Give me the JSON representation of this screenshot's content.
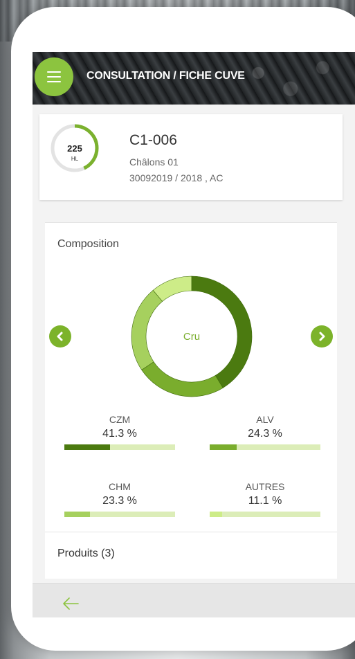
{
  "header": {
    "title": "CONSULTATION / FICHE CUVE",
    "menu_icon": "hamburger-menu-icon"
  },
  "tank": {
    "volume": "225",
    "unit": "HL",
    "fill_fraction": 0.43,
    "code": "C1-006",
    "location": "Châlons 01",
    "lot": "30092019 / 2018 , AC"
  },
  "composition": {
    "title": "Composition",
    "center_label": "Cru",
    "prev_icon": "chevron-left-icon",
    "next_icon": "chevron-right-icon",
    "chart_data": {
      "type": "pie",
      "categories": [
        "CZM",
        "ALV",
        "CHM",
        "AUTRES"
      ],
      "values": [
        41.3,
        24.3,
        23.3,
        11.1
      ],
      "colors": [
        "#4b7a10",
        "#7aad2d",
        "#a6d05e",
        "#cdec88"
      ],
      "title": ""
    },
    "items": [
      {
        "name": "CZM",
        "percent": "41.3 %",
        "value": 41.3
      },
      {
        "name": "ALV",
        "percent": "24.3 %",
        "value": 24.3
      },
      {
        "name": "CHM",
        "percent": "23.3 %",
        "value": 23.3
      },
      {
        "name": "AUTRES",
        "percent": "11.1 %",
        "value": 11.1
      }
    ],
    "bar_track_color": "#dcedb8"
  },
  "products": {
    "title": "Produits (3)"
  },
  "footer": {
    "back_icon": "arrow-left-icon"
  },
  "colors": {
    "accent": "#8cc43f"
  }
}
